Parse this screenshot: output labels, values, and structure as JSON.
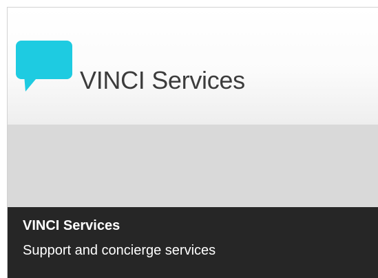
{
  "tile": {
    "header_title": "VINCI Services",
    "icon": "speech-bubble-icon",
    "accent_color": "#1ecbe1",
    "footer": {
      "title": "VINCI Services",
      "subtitle": "Support and concierge services"
    }
  }
}
